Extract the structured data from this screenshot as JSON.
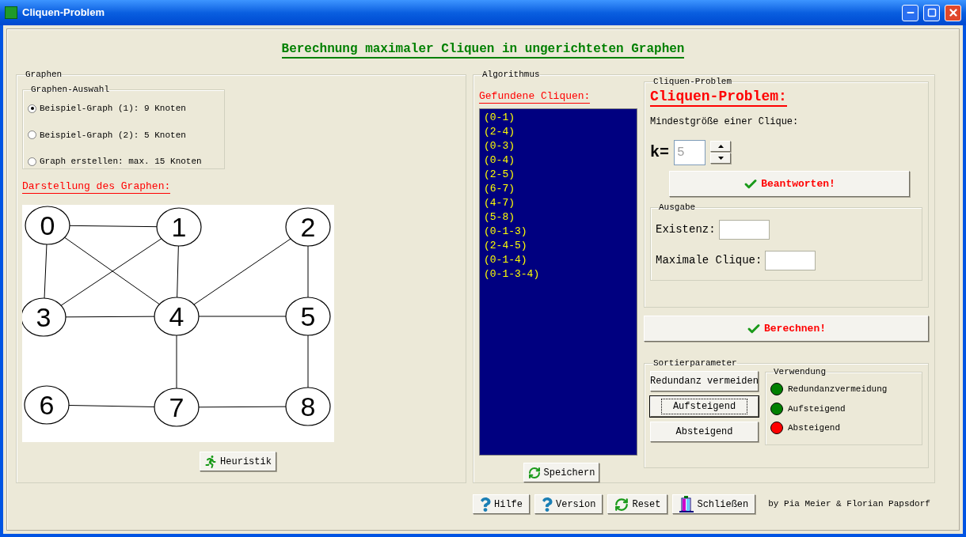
{
  "window": {
    "title": "Cliquen-Problem"
  },
  "heading": "Berechnung maximaler Cliquen in ungerichteten Graphen",
  "graph_panel": {
    "title": "Graphen",
    "selection": {
      "title": "Graphen-Auswahl",
      "options": [
        {
          "label": "Beispiel-Graph (1): 9 Knoten",
          "selected": true
        },
        {
          "label": "Beispiel-Graph (2): 5 Knoten",
          "selected": false
        },
        {
          "label": "Graph erstellen: max. 15 Knoten",
          "selected": false
        }
      ]
    },
    "display_label": "Darstellung des Graphen:",
    "nodes": [
      "0",
      "1",
      "2",
      "3",
      "4",
      "5",
      "6",
      "7",
      "8"
    ],
    "heuristic_button": "Heuristik"
  },
  "algorithm_panel": {
    "title": "Algorithmus",
    "found_label": "Gefundene Cliquen:",
    "cliques": [
      "(0-1)",
      "(2-4)",
      "(0-3)",
      "(0-4)",
      "(2-5)",
      "(6-7)",
      "(4-7)",
      "(5-8)",
      "(0-1-3)",
      "(2-4-5)",
      "(0-1-4)",
      "(0-1-3-4)"
    ],
    "save_button": "Speichern",
    "problem": {
      "title": "Cliquen-Problem",
      "heading": "Cliquen-Problem:",
      "min_label": "Mindestgröße einer Clique:",
      "k_label": "k=",
      "k_value": "5",
      "k_disabled": true,
      "answer_button": "Beantworten!",
      "output": {
        "title": "Ausgabe",
        "existence_label": "Existenz:",
        "max_label": "Maximale Clique:"
      }
    },
    "compute_button": "Berechnen!",
    "sorting": {
      "title": "Sortierparameter",
      "buttons": [
        {
          "label": "Redundanz vermeiden",
          "focused": false
        },
        {
          "label": "Aufsteigend",
          "focused": true
        },
        {
          "label": "Absteigend",
          "focused": false
        }
      ],
      "usage": {
        "title": "Verwendung",
        "items": [
          {
            "label": "Redundanzvermeidung",
            "color": "#008000"
          },
          {
            "label": "Aufsteigend",
            "color": "#008000"
          },
          {
            "label": "Absteigend",
            "color": "#ff0000"
          }
        ]
      }
    }
  },
  "footer": {
    "buttons": [
      {
        "kind": "help",
        "label": "Hilfe"
      },
      {
        "kind": "help",
        "label": "Version"
      },
      {
        "kind": "refresh",
        "label": "Reset"
      },
      {
        "kind": "exit",
        "label": "Schließen"
      }
    ],
    "credit": "by Pia Meier & Florian Papsdorf"
  }
}
